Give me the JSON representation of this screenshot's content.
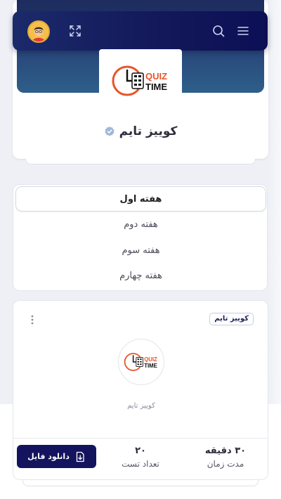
{
  "profile": {
    "title": "کوییز تایم",
    "logo_line1": "QUIZ",
    "logo_line2": "TIME"
  },
  "weeks": [
    {
      "label": "هفته اول",
      "active": true
    },
    {
      "label": "هفته دوم",
      "active": false
    },
    {
      "label": "هفته سوم",
      "active": false
    },
    {
      "label": "هفته چهارم",
      "active": false
    }
  ],
  "quiz_card": {
    "tag": "کوییز تایم",
    "name": "کوییز تایم",
    "duration_value": "۳۰ دقیقه",
    "duration_label": "مدت زمان",
    "count_value": "۲۰",
    "count_label": "تعداد تست",
    "download_label": "دانلود فایل"
  },
  "colors": {
    "navbar": "#13195a",
    "button": "#14145e",
    "logo_orange": "#e8542a"
  },
  "icons": {
    "menu": "hamburger-icon",
    "search": "search-icon",
    "fullscreen": "expand-icon",
    "verified": "verified-badge-icon",
    "more": "kebab-icon",
    "download": "download-file-icon"
  }
}
